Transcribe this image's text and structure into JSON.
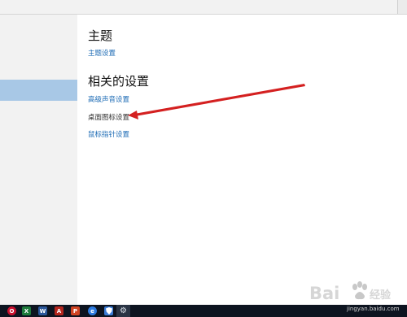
{
  "sections": {
    "theme": {
      "heading": "主题",
      "link": "主题设置"
    },
    "related": {
      "heading": "相关的设置",
      "links": [
        "高级声音设置",
        "桌面图标设置",
        "鼠标指针设置"
      ]
    }
  },
  "watermark": {
    "text": "Bai经验",
    "subtext": "jingyan.baidu.com"
  },
  "colors": {
    "accent": "#1d6bb5",
    "selection": "#a8c8e6",
    "annotation_arrow": "#d42020",
    "taskbar": "#0d1420"
  },
  "taskbar": {
    "icons": [
      "opera-icon",
      "excel-icon",
      "word-icon",
      "acrobat-icon",
      "powerpoint-icon",
      "qq-browser-icon",
      "shield-icon",
      "settings-gear-icon"
    ]
  }
}
